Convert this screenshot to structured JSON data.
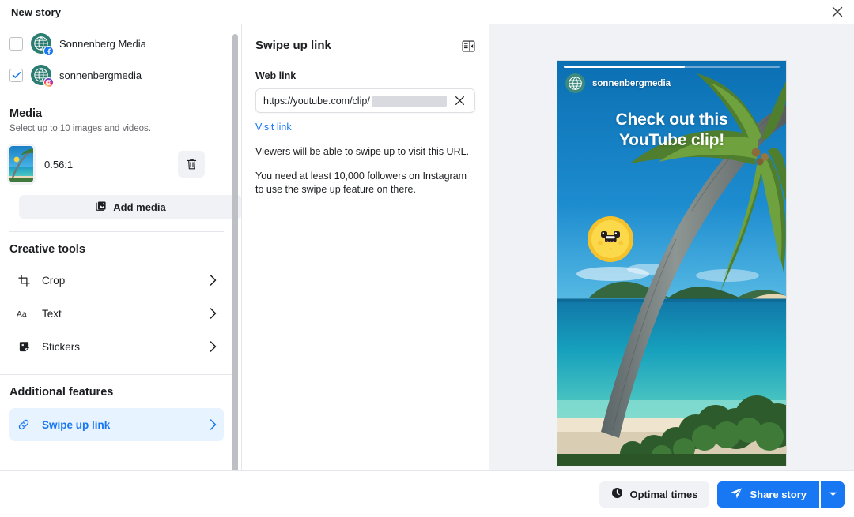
{
  "window": {
    "title": "New story",
    "close_icon": "close-icon"
  },
  "sidebar": {
    "accounts": [
      {
        "name": "Sonnenberg Media",
        "platform": "facebook",
        "checked": false
      },
      {
        "name": "sonnenbergmedia",
        "platform": "instagram",
        "checked": true
      }
    ],
    "media": {
      "title": "Media",
      "subtitle": "Select up to 10 images and videos.",
      "items": [
        {
          "ratio": "0.56:1",
          "delete_icon": "trash-icon"
        }
      ],
      "add_button": "Add media",
      "add_icon": "image-icon"
    },
    "creative_tools": {
      "title": "Creative tools",
      "items": [
        {
          "label": "Crop",
          "icon": "crop-icon"
        },
        {
          "label": "Text",
          "icon": "text-aa-icon"
        },
        {
          "label": "Stickers",
          "icon": "sticker-icon"
        }
      ]
    },
    "additional_features": {
      "title": "Additional features",
      "items": [
        {
          "label": "Swipe up link",
          "icon": "link-icon",
          "active": true
        }
      ]
    }
  },
  "middle": {
    "title": "Swipe up link",
    "panel_icon": "panel-layout-icon",
    "web_link_label": "Web link",
    "url_value": "https://youtube.com/clip/",
    "url_redacted": true,
    "clear_icon": "close-icon",
    "visit_link": "Visit link",
    "help_line_1": "Viewers will be able to swipe up to visit this URL.",
    "help_line_2": "You need at least 10,000 followers on Instagram to use the swipe up feature on there."
  },
  "preview": {
    "username": "sonnenbergmedia",
    "caption_line_1": "Check out this",
    "caption_line_2": "YouTube clip!",
    "progress_percent": 56,
    "sticker": "smiling-sun-sticker"
  },
  "footer": {
    "optimal_times_label": "Optimal times",
    "optimal_times_icon": "clock-icon",
    "share_label": "Share story",
    "share_icon": "paper-plane-icon",
    "caret_icon": "chevron-down-icon"
  },
  "colors": {
    "accent": "#1877f2",
    "accent_soft": "#e7f3ff",
    "surface": "#f0f2f5",
    "border": "#e4e6eb",
    "text": "#1c1e21",
    "muted": "#65676b",
    "avatar_teal": "#2b7d72"
  }
}
